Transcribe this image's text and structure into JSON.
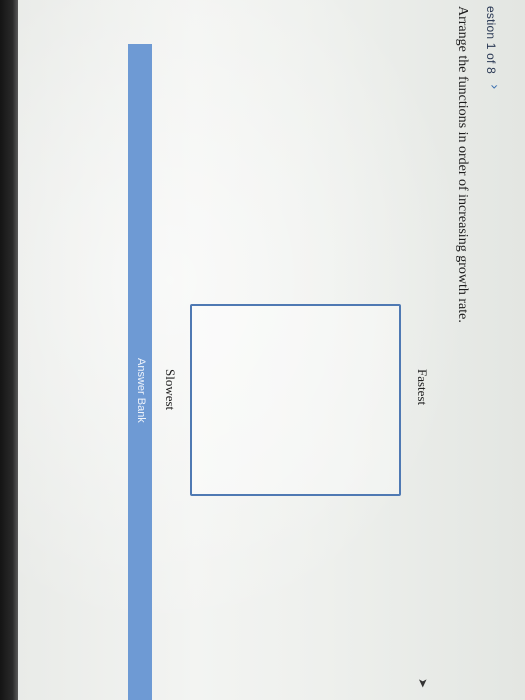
{
  "header": {
    "question_counter": "estion 1 of 8",
    "next_label": "›"
  },
  "question": {
    "prompt": "Arrange the functions in order of increasing growth rate."
  },
  "ordering": {
    "top_label": "Fastest",
    "bottom_label": "Slowest"
  },
  "answer_bank": {
    "label": "Answer Bank"
  },
  "cursor": {
    "glyph": "➤"
  },
  "colors": {
    "accent": "#4f79b3",
    "answer_bank_bg": "#6e9ad4",
    "bezel": "#141414"
  }
}
